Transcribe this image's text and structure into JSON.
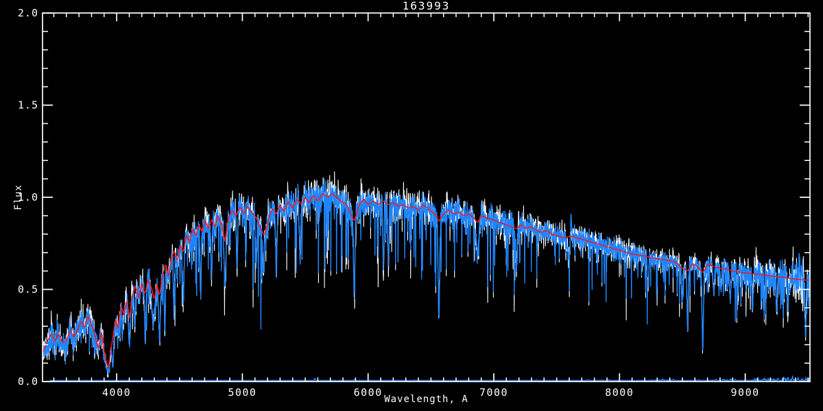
{
  "window": {
    "background": "#000000",
    "foreground": "#FFFFFF"
  },
  "chart_data": {
    "type": "line",
    "title": "163993",
    "xlabel": "Wavelength, A",
    "ylabel": "Flux",
    "xlim": [
      3410,
      9515
    ],
    "ylim": [
      0.0,
      2.0
    ],
    "grid": false,
    "legend": null,
    "x_major_ticks": [
      4000,
      5000,
      6000,
      7000,
      8000,
      9000
    ],
    "x_tick_labels": [
      "4000",
      "5000",
      "6000",
      "7000",
      "8000",
      "9000"
    ],
    "x_minor_tick_step": 100,
    "y_major_ticks": [
      0.0,
      0.5,
      1.0,
      1.5,
      2.0
    ],
    "y_tick_labels": [
      "0.0",
      "0.5",
      "1.0",
      "1.5",
      "2.0"
    ],
    "y_minor_tick_step": 0.1,
    "series": [
      {
        "name": "observed-spectrum",
        "color": "#FFFFFF",
        "style": "noisy-line"
      },
      {
        "name": "smoothed-spectrum",
        "color": "#1E86FF",
        "style": "noisy-line"
      },
      {
        "name": "model-fit",
        "color": "#FF1414",
        "style": "smooth-line"
      },
      {
        "name": "sky-background",
        "color": "#1E86FF",
        "style": "baseline",
        "base_flux": 0.006
      }
    ],
    "model_points": [
      [
        3410,
        0.155
      ],
      [
        3450,
        0.22
      ],
      [
        3480,
        0.26
      ],
      [
        3510,
        0.22
      ],
      [
        3540,
        0.26
      ],
      [
        3570,
        0.21
      ],
      [
        3600,
        0.22
      ],
      [
        3630,
        0.28
      ],
      [
        3660,
        0.24
      ],
      [
        3690,
        0.28
      ],
      [
        3720,
        0.33
      ],
      [
        3745,
        0.29
      ],
      [
        3770,
        0.36
      ],
      [
        3800,
        0.31
      ],
      [
        3830,
        0.24
      ],
      [
        3855,
        0.18
      ],
      [
        3880,
        0.27
      ],
      [
        3905,
        0.14
      ],
      [
        3934,
        0.07
      ],
      [
        3950,
        0.16
      ],
      [
        3970,
        0.24
      ],
      [
        3990,
        0.34
      ],
      [
        4010,
        0.29
      ],
      [
        4035,
        0.41
      ],
      [
        4060,
        0.36
      ],
      [
        4080,
        0.45
      ],
      [
        4101,
        0.34
      ],
      [
        4125,
        0.47
      ],
      [
        4150,
        0.52
      ],
      [
        4175,
        0.45
      ],
      [
        4200,
        0.54
      ],
      [
        4227,
        0.47
      ],
      [
        4250,
        0.56
      ],
      [
        4280,
        0.5
      ],
      [
        4300,
        0.44
      ],
      [
        4320,
        0.53
      ],
      [
        4340,
        0.46
      ],
      [
        4365,
        0.58
      ],
      [
        4390,
        0.64
      ],
      [
        4410,
        0.57
      ],
      [
        4435,
        0.67
      ],
      [
        4460,
        0.71
      ],
      [
        4481,
        0.65
      ],
      [
        4505,
        0.74
      ],
      [
        4530,
        0.7
      ],
      [
        4555,
        0.8
      ],
      [
        4580,
        0.75
      ],
      [
        4605,
        0.83
      ],
      [
        4630,
        0.79
      ],
      [
        4655,
        0.85
      ],
      [
        4680,
        0.81
      ],
      [
        4705,
        0.87
      ],
      [
        4730,
        0.83
      ],
      [
        4755,
        0.88
      ],
      [
        4780,
        0.84
      ],
      [
        4805,
        0.9
      ],
      [
        4830,
        0.86
      ],
      [
        4861,
        0.76
      ],
      [
        4890,
        0.89
      ],
      [
        4920,
        0.93
      ],
      [
        4950,
        0.9
      ],
      [
        4980,
        0.95
      ],
      [
        5010,
        0.91
      ],
      [
        5040,
        0.95
      ],
      [
        5070,
        0.92
      ],
      [
        5110,
        0.89
      ],
      [
        5140,
        0.84
      ],
      [
        5175,
        0.79
      ],
      [
        5210,
        0.89
      ],
      [
        5240,
        0.94
      ],
      [
        5270,
        0.91
      ],
      [
        5300,
        0.96
      ],
      [
        5330,
        0.92
      ],
      [
        5365,
        0.98
      ],
      [
        5400,
        0.94
      ],
      [
        5435,
        0.99
      ],
      [
        5470,
        0.96
      ],
      [
        5500,
        1.0
      ],
      [
        5530,
        0.97
      ],
      [
        5560,
        1.01
      ],
      [
        5600,
        0.98
      ],
      [
        5640,
        1.02
      ],
      [
        5680,
        1.0
      ],
      [
        5711,
        1.02
      ],
      [
        5750,
        1.0
      ],
      [
        5780,
        0.98
      ],
      [
        5830,
        0.96
      ],
      [
        5890,
        0.87
      ],
      [
        5930,
        0.96
      ],
      [
        5965,
        0.99
      ],
      [
        6000,
        0.96
      ],
      [
        6040,
        0.98
      ],
      [
        6080,
        0.96
      ],
      [
        6120,
        0.98
      ],
      [
        6160,
        0.96
      ],
      [
        6200,
        0.97
      ],
      [
        6240,
        0.95
      ],
      [
        6280,
        0.96
      ],
      [
        6320,
        0.94
      ],
      [
        6360,
        0.95
      ],
      [
        6400,
        0.93
      ],
      [
        6440,
        0.96
      ],
      [
        6490,
        0.93
      ],
      [
        6530,
        0.91
      ],
      [
        6563,
        0.87
      ],
      [
        6600,
        0.91
      ],
      [
        6640,
        0.93
      ],
      [
        6680,
        0.91
      ],
      [
        6720,
        0.92
      ],
      [
        6760,
        0.9
      ],
      [
        6800,
        0.91
      ],
      [
        6840,
        0.89
      ],
      [
        6870,
        0.86
      ],
      [
        6900,
        0.9
      ],
      [
        6940,
        0.89
      ],
      [
        6980,
        0.88
      ],
      [
        7020,
        0.87
      ],
      [
        7060,
        0.86
      ],
      [
        7100,
        0.85
      ],
      [
        7140,
        0.84
      ],
      [
        7180,
        0.83
      ],
      [
        7220,
        0.85
      ],
      [
        7260,
        0.83
      ],
      [
        7300,
        0.84
      ],
      [
        7340,
        0.82
      ],
      [
        7380,
        0.81
      ],
      [
        7420,
        0.82
      ],
      [
        7460,
        0.8
      ],
      [
        7510,
        0.79
      ],
      [
        7560,
        0.78
      ],
      [
        7610,
        0.79
      ],
      [
        7660,
        0.78
      ],
      [
        7710,
        0.77
      ],
      [
        7760,
        0.76
      ],
      [
        7810,
        0.75
      ],
      [
        7860,
        0.74
      ],
      [
        7910,
        0.73
      ],
      [
        7960,
        0.72
      ],
      [
        8010,
        0.71
      ],
      [
        8060,
        0.7
      ],
      [
        8110,
        0.69
      ],
      [
        8160,
        0.685
      ],
      [
        8210,
        0.68
      ],
      [
        8260,
        0.67
      ],
      [
        8310,
        0.665
      ],
      [
        8360,
        0.66
      ],
      [
        8410,
        0.655
      ],
      [
        8460,
        0.64
      ],
      [
        8498,
        0.615
      ],
      [
        8542,
        0.6
      ],
      [
        8580,
        0.64
      ],
      [
        8620,
        0.625
      ],
      [
        8662,
        0.59
      ],
      [
        8700,
        0.635
      ],
      [
        8750,
        0.625
      ],
      [
        8800,
        0.615
      ],
      [
        8850,
        0.61
      ],
      [
        8900,
        0.6
      ],
      [
        8950,
        0.595
      ],
      [
        9000,
        0.59
      ],
      [
        9060,
        0.585
      ],
      [
        9120,
        0.58
      ],
      [
        9180,
        0.575
      ],
      [
        9240,
        0.57
      ],
      [
        9300,
        0.565
      ],
      [
        9360,
        0.56
      ],
      [
        9420,
        0.555
      ],
      [
        9480,
        0.55
      ],
      [
        9515,
        0.55
      ]
    ],
    "absorption_features": [
      [
        3934,
        0.05,
        9
      ],
      [
        3968,
        0.09,
        7
      ],
      [
        4045,
        0.25,
        5
      ],
      [
        4101,
        0.22,
        6
      ],
      [
        4144,
        0.3,
        5
      ],
      [
        4227,
        0.22,
        5
      ],
      [
        4290,
        0.32,
        10
      ],
      [
        4340,
        0.25,
        6
      ],
      [
        4383,
        0.3,
        5
      ],
      [
        4455,
        0.38,
        5
      ],
      [
        4530,
        0.42,
        5
      ],
      [
        4668,
        0.5,
        5
      ],
      [
        4754,
        0.55,
        5
      ],
      [
        4861,
        0.52,
        6
      ],
      [
        4957,
        0.62,
        5
      ],
      [
        5110,
        0.63,
        5
      ],
      [
        5167,
        0.58,
        6
      ],
      [
        5270,
        0.6,
        5
      ],
      [
        5460,
        0.68,
        5
      ],
      [
        5890,
        0.5,
        6
      ],
      [
        6122,
        0.62,
        5
      ],
      [
        6162,
        0.64,
        5
      ],
      [
        6563,
        0.37,
        6
      ],
      [
        6870,
        0.7,
        12
      ],
      [
        7180,
        0.62,
        6
      ],
      [
        7594,
        0.68,
        10
      ],
      [
        8227,
        0.5,
        5
      ],
      [
        8498,
        0.42,
        5
      ],
      [
        8542,
        0.3,
        5
      ],
      [
        8662,
        0.19,
        5
      ],
      [
        8750,
        0.48,
        5
      ],
      [
        8806,
        0.5,
        5
      ],
      [
        8880,
        0.45,
        5
      ],
      [
        9060,
        0.42,
        5
      ],
      [
        9150,
        0.45,
        5
      ],
      [
        9250,
        0.4,
        5
      ],
      [
        9340,
        0.38,
        5
      ],
      [
        9480,
        0.27,
        5
      ]
    ],
    "emission_artifacts": [
      [
        7615,
        0.92,
        4
      ],
      [
        9430,
        0.72,
        3
      ]
    ],
    "sky_bumps": [
      [
        5577,
        0.018
      ],
      [
        5890,
        0.012
      ],
      [
        6300,
        0.012
      ],
      [
        6364,
        0.01
      ],
      [
        7340,
        0.01
      ],
      [
        7750,
        0.011
      ],
      [
        7860,
        0.01
      ],
      [
        7913,
        0.011
      ],
      [
        8344,
        0.013
      ],
      [
        8430,
        0.013
      ],
      [
        8630,
        0.011
      ],
      [
        8767,
        0.013
      ],
      [
        8827,
        0.013
      ],
      [
        8885,
        0.015
      ],
      [
        8919,
        0.013
      ],
      [
        9001,
        0.011
      ],
      [
        9150,
        0.017
      ],
      [
        9210,
        0.015
      ],
      [
        9260,
        0.018
      ],
      [
        9310,
        0.02
      ],
      [
        9340,
        0.017
      ],
      [
        9376,
        0.022
      ],
      [
        9420,
        0.018
      ],
      [
        9450,
        0.016
      ],
      [
        9480,
        0.014
      ]
    ],
    "noise_profile": {
      "base_sigma": 0.042,
      "blue_end_extra_below_4450": 0.1,
      "red_end_extra_above_8800": 0.07,
      "spike_probability": 0.11,
      "deep_spike_probability": 0.012,
      "sky_start_wavelength": 3465
    }
  }
}
